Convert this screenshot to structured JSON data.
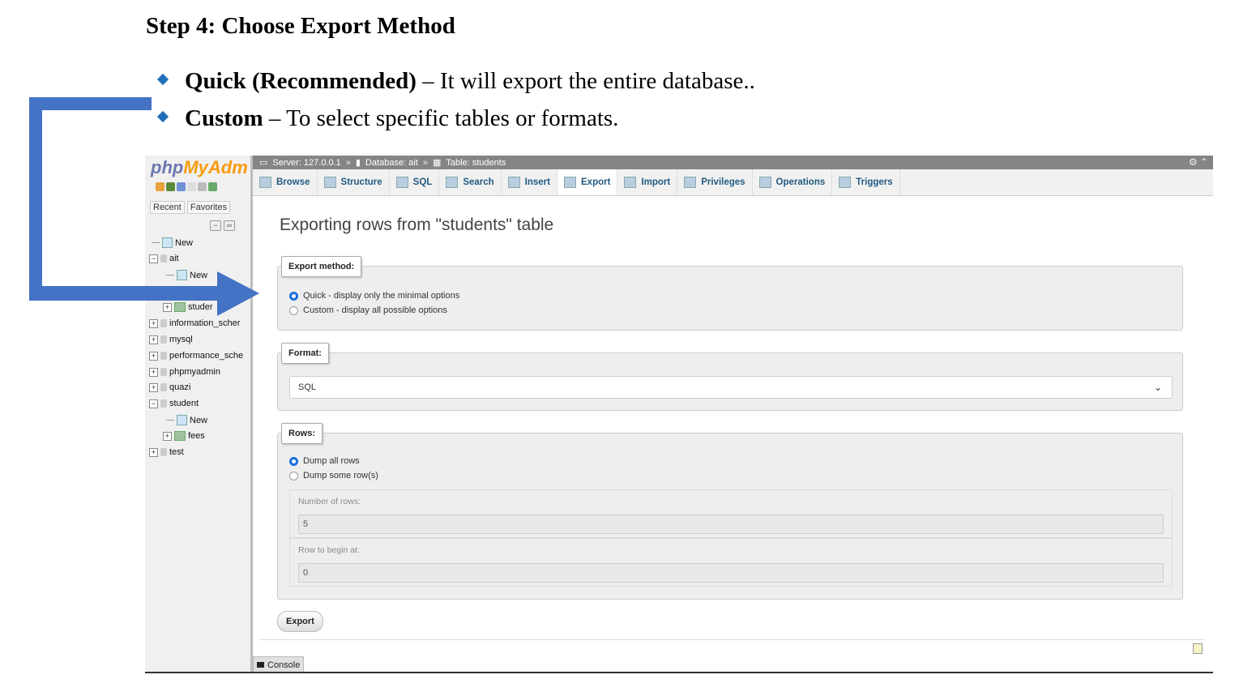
{
  "document": {
    "step_title": "Step 4: Choose Export Method",
    "bullets": [
      {
        "bold": "Quick (Recommended)",
        "text": " – It will export the entire database.."
      },
      {
        "bold": "Custom",
        "text": " – To select specific tables or formats."
      }
    ],
    "arrow_color": "#4472c4",
    "bullet_color": "#1f6fb8"
  },
  "nav": {
    "logo_php": "php",
    "logo_my": "MyAdm",
    "recent": "Recent",
    "favorites": "Favorites",
    "tree": [
      "New",
      "ait",
      "New",
      "studer",
      "information_scher",
      "mysql",
      "performance_sche",
      "phpmyadmin",
      "quazi",
      "student",
      "New",
      "fees",
      "test"
    ]
  },
  "breadcrumb": {
    "server": "Server: 127.0.0.1",
    "database": "Database: ait",
    "table": "Table: students"
  },
  "tabs": [
    "Browse",
    "Structure",
    "SQL",
    "Search",
    "Insert",
    "Export",
    "Import",
    "Privileges",
    "Operations",
    "Triggers"
  ],
  "active_tab": "Export",
  "main": {
    "title": "Exporting rows from \"students\" table",
    "export_method": {
      "legend": "Export method:",
      "options": [
        "Quick - display only the minimal options",
        "Custom - display all possible options"
      ],
      "selected": "Quick - display only the minimal options"
    },
    "format": {
      "legend": "Format:",
      "value": "SQL"
    },
    "rows": {
      "legend": "Rows:",
      "options": [
        "Dump all rows",
        "Dump some row(s)"
      ],
      "selected": "Dump all rows",
      "number_label": "Number of rows:",
      "number_value": "5",
      "begin_label": "Row to begin at:",
      "begin_value": "0"
    },
    "export_button": "Export"
  },
  "console": "Console"
}
